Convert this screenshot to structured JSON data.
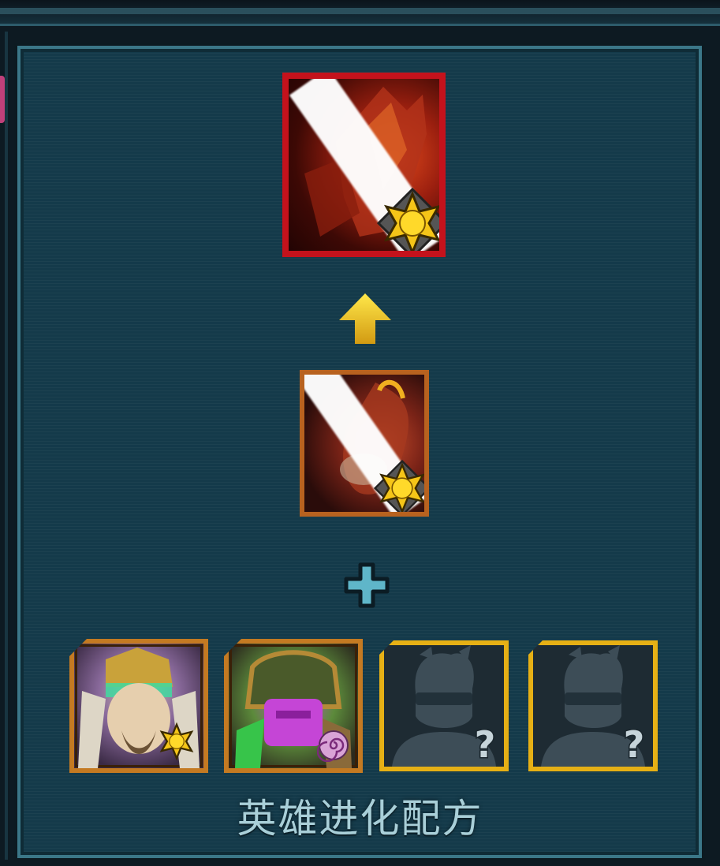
{
  "recipe": {
    "title": "英雄进化配方"
  },
  "target_hero": {
    "frame_color": "#c4121c",
    "rank_icon": "sun-star-badge-icon"
  },
  "base_hero": {
    "frame_color": "#b8621f",
    "rank_icon": "sun-star-badge-icon"
  },
  "evolve_icon": "up-arrow-icon",
  "combine_icon": "plus-icon",
  "materials": [
    {
      "kind": "hero",
      "badge_icon": "sun-star-badge-icon"
    },
    {
      "kind": "hero",
      "badge_icon": "swirl-badge-icon"
    },
    {
      "kind": "unknown",
      "badge_icon": "question-mark-icon"
    },
    {
      "kind": "unknown",
      "badge_icon": "question-mark-icon"
    }
  ],
  "colors": {
    "panel_bg": "#143a4a",
    "panel_border": "#3b7788",
    "empty_slot_border": "#e6b015",
    "hero_slot_border": "#c47a22",
    "title_text": "#a9cfd8"
  }
}
